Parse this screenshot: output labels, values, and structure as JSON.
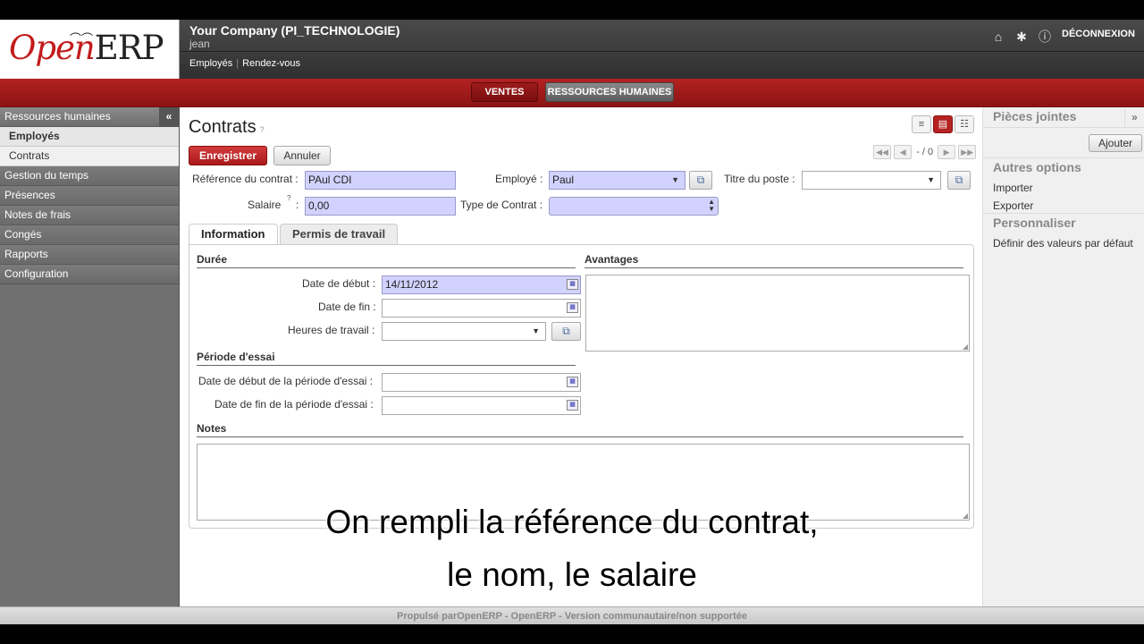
{
  "header": {
    "logo_open": "Open",
    "logo_erp": "ERP",
    "company": "Your Company (PI_TECHNOLOGIE)",
    "user": "jean",
    "submenu": [
      "Employés",
      "Rendez-vous"
    ],
    "logout": "DÉCONNEXION"
  },
  "topmenu": {
    "ventes": "VENTES",
    "rh": "RESSOURCES HUMAINES"
  },
  "sidebar": {
    "collapse": "«",
    "section": "Ressources humaines",
    "sub_employes": "Employés",
    "sub_contrats": "Contrats",
    "items": [
      "Gestion du temps",
      "Présences",
      "Notes de frais",
      "Congés",
      "Rapports",
      "Configuration"
    ]
  },
  "main": {
    "title": "Contrats",
    "help": "?",
    "pager": "- / 0",
    "save": "Enregistrer",
    "cancel": "Annuler"
  },
  "form": {
    "ref_label": "Référence du contrat :",
    "ref_value": "PAul CDI",
    "employe_label": "Employé :",
    "employe_value": "Paul",
    "poste_label": "Titre du poste :",
    "poste_value": "",
    "salaire_label": "Salaire",
    "salaire_help": "?",
    "salaire_colon": ":",
    "salaire_value": "0,00",
    "type_label": "Type de Contrat :",
    "type_value": ""
  },
  "tabs": {
    "information": "Information",
    "permis": "Permis de travail"
  },
  "info": {
    "duree": "Durée",
    "debut_label": "Date de début :",
    "debut_value": "14/11/2012",
    "fin_label": "Date de fin :",
    "fin_value": "",
    "heures_label": "Heures de travail :",
    "heures_value": "",
    "essai": "Période d'essai",
    "essai_debut_label": "Date de début de la période d'essai :",
    "essai_fin_label": "Date de fin de la période d'essai :",
    "avantages": "Avantages",
    "notes": "Notes"
  },
  "rpanel": {
    "collapse": "»",
    "pieces": "Pièces jointes",
    "ajouter": "Ajouter",
    "autres": "Autres options",
    "importer": "Importer",
    "exporter": "Exporter",
    "personnaliser": "Personnaliser",
    "definir": "Définir des valeurs par défaut"
  },
  "footer": "Propulsé parOpenERP - OpenERP - Version communautaire/non supportée",
  "subtitles": [
    "On rempli la référence du contrat,",
    "le nom, le salaire"
  ]
}
